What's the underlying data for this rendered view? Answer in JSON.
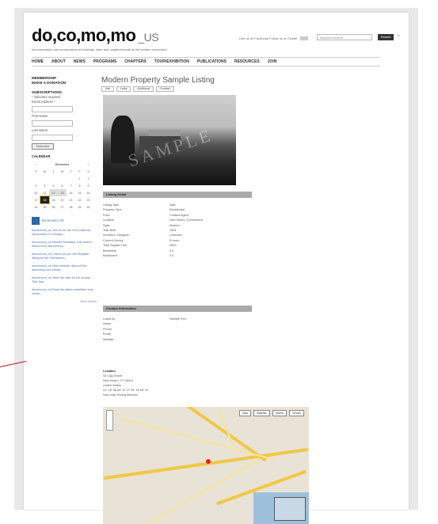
{
  "header": {
    "logo": "do,co,mo,mo",
    "logo_suffix": "_US",
    "tagline": "documentation and conservation of buildings, sites and neighborhoods of the modern movement",
    "search_placeholder": "Keyword search",
    "search_button": "Search",
    "top_links": "Like us on Facebook  Follow us on Twitter"
  },
  "nav": [
    "HOME",
    "ABOUT",
    "NEWS",
    "PROGRAMS",
    "CHAPTERS",
    "TOUR/EXHIBITION",
    "PUBLICATIONS",
    "RESOURCES",
    "JOIN"
  ],
  "sidebar": {
    "membership": "MEMBERSHIP",
    "donation": "MAKE A DONATION",
    "subscriptions": "SUBSCRIPTIONS",
    "sub_note": "* indicates required",
    "email_label": "Email Address *",
    "first_label": "First Name",
    "last_label": "Last Name",
    "subscribe_btn": "Subscribe",
    "calendar_title": "CALENDAR",
    "month": "December",
    "weekdays": [
      "S",
      "M",
      "T",
      "W",
      "T",
      "F",
      "S"
    ],
    "weeks": [
      [
        "",
        "",
        "",
        "",
        "",
        "1",
        "2"
      ],
      [
        "3",
        "4",
        "5",
        "6",
        "7",
        "8",
        "9"
      ],
      [
        "10",
        "11",
        "12",
        "13",
        "14",
        "15",
        "16"
      ],
      [
        "17",
        "18",
        "19",
        "20",
        "21",
        "22",
        "23"
      ],
      [
        "24",
        "25",
        "26",
        "27",
        "28",
        "29",
        "30"
      ]
    ],
    "twitter_handle": "docomomo US",
    "tweets": [
      "docomomo_us Join us for the 2012 National Symposium in Chicago...",
      "docomomo_us Modern Mondays: this week's feature is a mid-century...",
      "docomomo_us Check out our new Register listing for the Farnsworth...",
      "docomomo_us New member discount for upcoming tour events...",
      "docomomo_us Save the date for our annual Tour Day...",
      "docomomo_us Read the latest newsletter now online..."
    ],
    "more": "More tweets"
  },
  "main": {
    "title": "Modern Property Sample Listing",
    "tabs": [
      "Info",
      "Links",
      "Additional",
      "Contact"
    ],
    "watermark": "SAMPLE",
    "listing_header": "Listing Detail",
    "listing": [
      [
        "Listing Type",
        "Sale"
      ],
      [
        "Property Type",
        "Residential"
      ],
      [
        "Price",
        "Contact Agent"
      ],
      [
        "Location",
        "New Haven, Connecticut"
      ],
      [
        "Style",
        "Modern"
      ],
      [
        "Year Built",
        "1954"
      ],
      [
        "Architect / Designer",
        "Unknown"
      ],
      [
        "Current Zoning",
        "R-zone"
      ],
      [
        "Total Square Feet",
        "2500"
      ],
      [
        "Bedrooms",
        "3.0"
      ],
      [
        "Bathrooms",
        "2.0"
      ]
    ],
    "contact_header": "Contact Information",
    "contact": [
      [
        "Listed by",
        "Sample Firm"
      ],
      [
        "Name",
        ""
      ],
      [
        "Phone",
        ""
      ],
      [
        "Email",
        ""
      ],
      [
        "Website",
        ""
      ]
    ],
    "location_label": "Location",
    "address_lines": [
      "43 Clay Street",
      "New Haven, CT 06514",
      "United States",
      "41° 18' 56.64\" N 72° 55' 15.84\" W",
      "New map  Driving direction"
    ],
    "map_types": [
      "Map",
      "Satellite",
      "Hybrid",
      "Terrain"
    ]
  }
}
